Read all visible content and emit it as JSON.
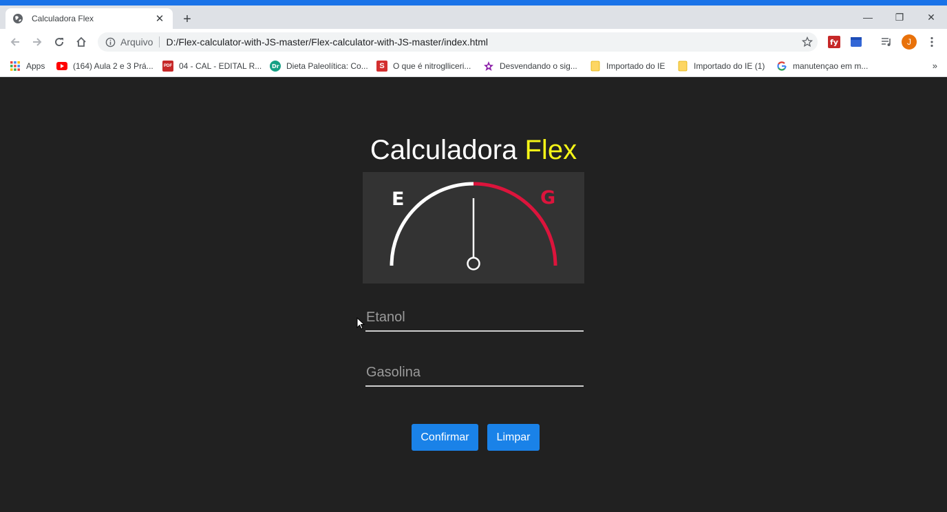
{
  "browser": {
    "tab": {
      "title": "Calculadora Flex",
      "close_glyph": "✕"
    },
    "new_tab_glyph": "+",
    "window_controls": {
      "minimize": "—",
      "maximize": "❐",
      "close": "✕"
    },
    "address_bar": {
      "scheme_label": "Arquivo",
      "url": "D:/Flex-calculator-with-JS-master/Flex-calculator-with-JS-master/index.html"
    },
    "profile_initial": "J",
    "accent_color": "#1a73e8"
  },
  "bookmarks": {
    "items": [
      {
        "label": "Apps",
        "icon": "apps-grid-icon"
      },
      {
        "label": "(164) Aula 2 e 3 Prá...",
        "icon": "youtube-icon"
      },
      {
        "label": "04 - CAL - EDITAL R...",
        "icon": "pdf-icon"
      },
      {
        "label": "Dieta Paleolítica: Co...",
        "icon": "site-dr-icon"
      },
      {
        "label": "O que é nitroglliceri...",
        "icon": "site-s-icon"
      },
      {
        "label": "Desvendando o sig...",
        "icon": "flower-icon"
      },
      {
        "label": "Importado do IE",
        "icon": "folder-icon"
      },
      {
        "label": "Importado do IE (1)",
        "icon": "folder-icon"
      },
      {
        "label": "manutençao em m...",
        "icon": "google-icon"
      }
    ],
    "more_glyph": "»"
  },
  "app": {
    "title_main": "Calculadora",
    "title_accent": "Flex",
    "gauge": {
      "left_label": "E",
      "right_label": "G",
      "left_color": "#ffffff",
      "right_color": "#dc143c",
      "needle_position": "center"
    },
    "inputs": {
      "etanol": {
        "placeholder": "Etanol",
        "value": ""
      },
      "gasolina": {
        "placeholder": "Gasolina",
        "value": ""
      }
    },
    "buttons": {
      "confirm_label": "Confirmar",
      "clear_label": "Limpar"
    },
    "colors": {
      "background": "#212121",
      "accent_yellow": "#f5f517",
      "button_blue": "#1a82e8"
    }
  }
}
